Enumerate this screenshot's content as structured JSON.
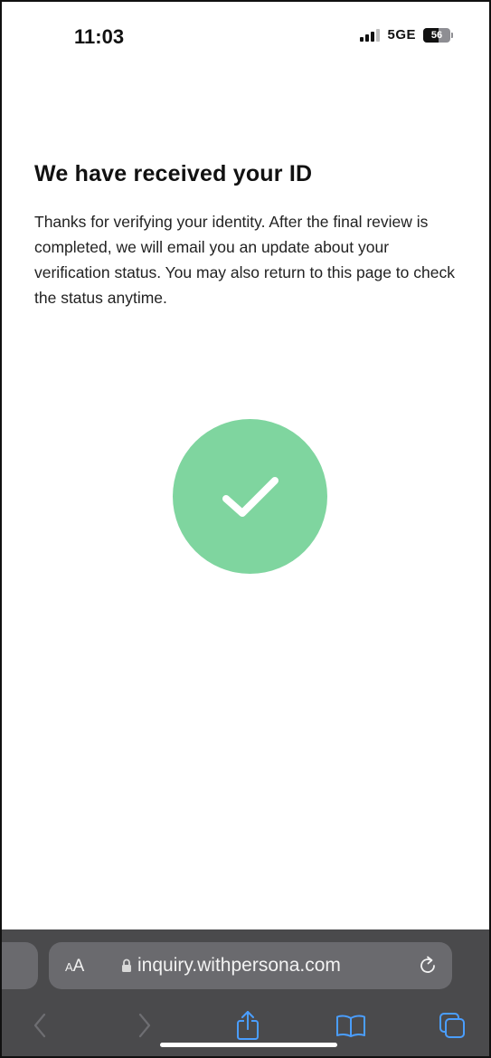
{
  "status_bar": {
    "time": "11:03",
    "network": "5GE",
    "battery_level": "56",
    "battery_fraction": 0.56
  },
  "page": {
    "title": "We have received your ID",
    "body": "Thanks for verifying your identity. After the final review is completed, we will email you an update about your verification status. You may also return to this page to check the status anytime.",
    "success_color": "#7fd59f"
  },
  "browser": {
    "aa_small": "A",
    "aa_large": "A",
    "url": "inquiry.withpersona.com",
    "icons": {
      "lock": "lock-icon",
      "reload": "reload-icon",
      "back": "chevron-left-icon",
      "forward": "chevron-right-icon",
      "share": "share-icon",
      "bookmarks": "book-icon",
      "tabs": "tabs-icon"
    },
    "accent_color": "#4a9eff",
    "disabled_color": "#6e6e72"
  }
}
